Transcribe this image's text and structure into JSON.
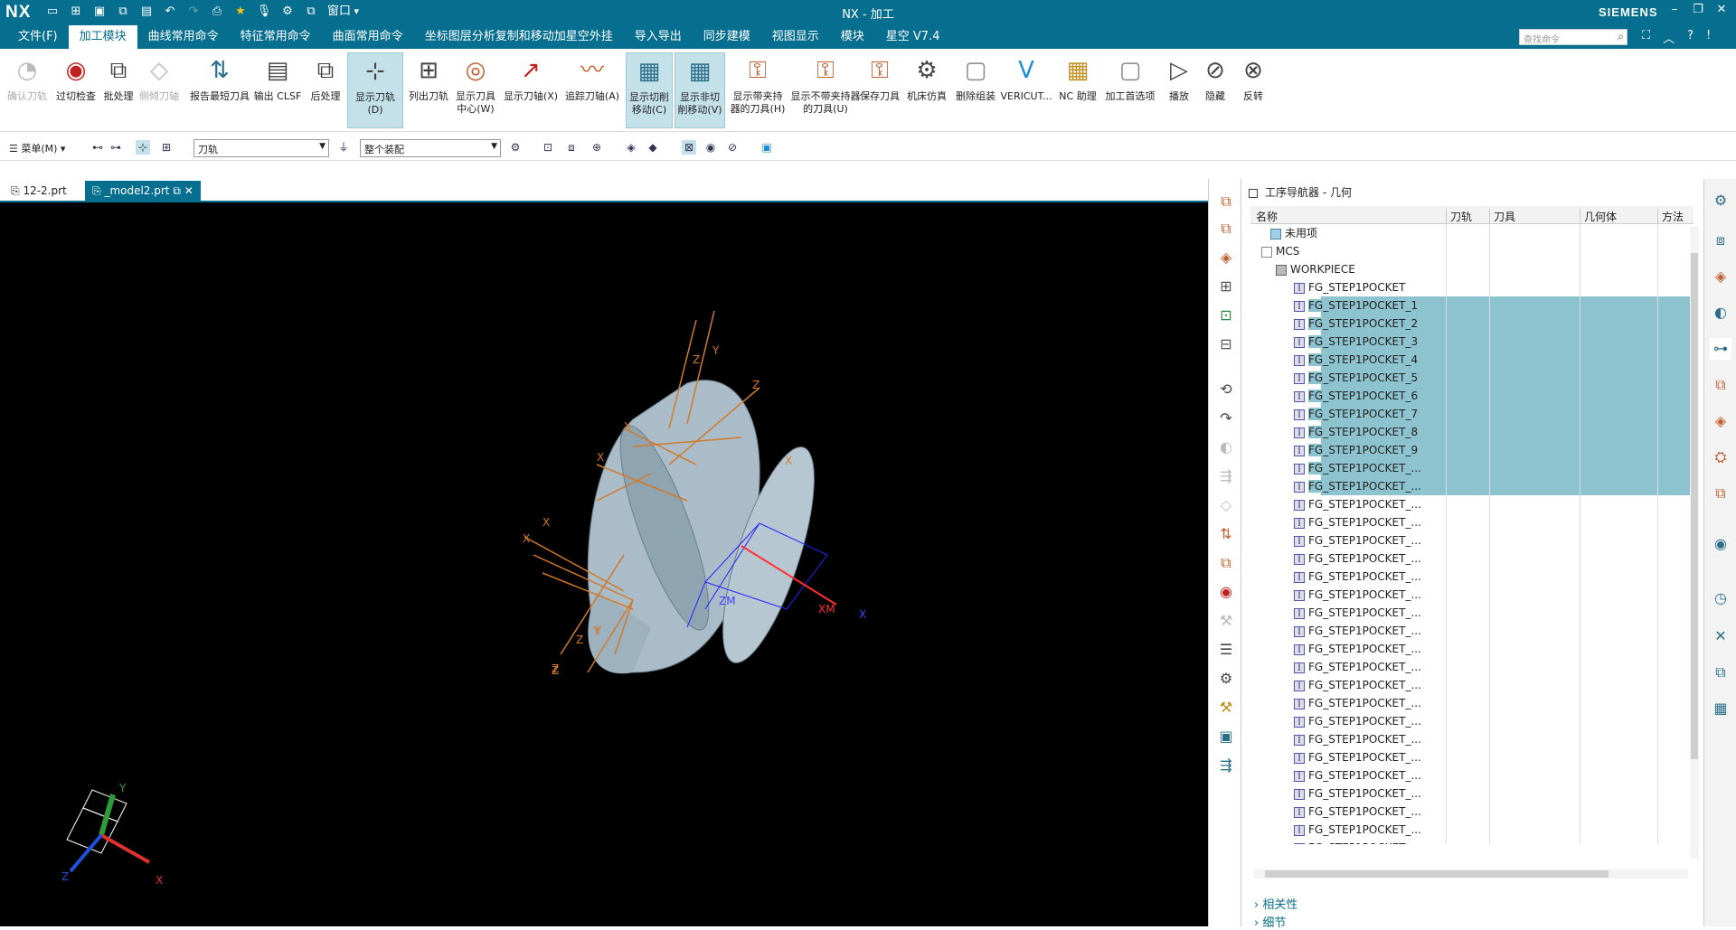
{
  "titlebar": {
    "logo": "NX",
    "title": "NX - 加工",
    "brand": "SIEMENS",
    "window_label": "窗口"
  },
  "menubar": {
    "items": [
      {
        "label": "文件(F)",
        "active": false
      },
      {
        "label": "加工模块",
        "active": true
      },
      {
        "label": "曲线常用命令",
        "active": false
      },
      {
        "label": "特征常用命令",
        "active": false
      },
      {
        "label": "曲面常用命令",
        "active": false
      },
      {
        "label": "坐标图层分析复制和移动加星空外挂",
        "active": false
      },
      {
        "label": "导入导出",
        "active": false
      },
      {
        "label": "同步建模",
        "active": false
      },
      {
        "label": "视图显示",
        "active": false
      },
      {
        "label": "模块",
        "active": false
      },
      {
        "label": "星空 V7.4",
        "active": false
      }
    ],
    "search_placeholder": "查找命令"
  },
  "ribbon": {
    "buttons": [
      {
        "label": "确认刀轨",
        "state": "disabled"
      },
      {
        "label": "过切检查",
        "state": "normal"
      },
      {
        "label": "批处理",
        "state": "normal"
      },
      {
        "label": "侧倾刀轴",
        "state": "disabled"
      },
      {
        "label": "报告最短刀具",
        "state": "normal"
      },
      {
        "label": "输出 CLSF",
        "state": "normal"
      },
      {
        "label": "后处理",
        "state": "normal"
      },
      {
        "label": "显示刀轨(D)",
        "state": "selected"
      },
      {
        "label": "列出刀轨",
        "state": "normal"
      },
      {
        "label": "显示刀具中心(W)",
        "state": "normal"
      },
      {
        "label": "显示刀轴(X)",
        "state": "normal"
      },
      {
        "label": "追踪刀轴(A)",
        "state": "normal"
      },
      {
        "label": "显示切削移动(C)",
        "state": "selected"
      },
      {
        "label": "显示非切削移动(V)",
        "state": "selected"
      },
      {
        "label": "显示带夹持器的刀具(H)",
        "state": "normal"
      },
      {
        "label": "显示不带夹持器的刀具(U)",
        "state": "normal"
      },
      {
        "label": "保存刀具",
        "state": "normal"
      },
      {
        "label": "机床仿真",
        "state": "normal"
      },
      {
        "label": "删除组装",
        "state": "normal"
      },
      {
        "label": "VERICUT...",
        "state": "normal"
      },
      {
        "label": "NC 助理",
        "state": "normal"
      },
      {
        "label": "加工首选项",
        "state": "normal"
      },
      {
        "label": "播放",
        "state": "normal"
      },
      {
        "label": "隐藏",
        "state": "normal"
      },
      {
        "label": "反转",
        "state": "normal"
      }
    ]
  },
  "toolbar2": {
    "menu_label": "菜单(M)",
    "filter_value": "刀轨",
    "scope_value": "整个装配"
  },
  "doctabs": [
    {
      "label": "12-2.prt",
      "active": false
    },
    {
      "label": "_model2.prt",
      "active": true
    }
  ],
  "viewport": {
    "triad": {
      "x": "X",
      "y": "Y",
      "z": "Z"
    },
    "labels": [
      "Z",
      "Y",
      "Z",
      "X",
      "X",
      "X",
      "X",
      "Z",
      "Z",
      "Y",
      "Z",
      "XM",
      "X",
      "ZM",
      "Y",
      "X"
    ]
  },
  "navigator": {
    "title": "工序导航器 - 几何",
    "columns": [
      "名称",
      "刀轨",
      "刀具",
      "几何体",
      "方法"
    ],
    "rows": [
      {
        "name": "未用项",
        "level": 0,
        "selected": false,
        "type": "folder"
      },
      {
        "name": "MCS",
        "level": 0,
        "selected": false,
        "type": "mcs"
      },
      {
        "name": "WORKPIECE",
        "level": 1,
        "selected": false,
        "type": "workpiece"
      },
      {
        "name": "FG_STEP1POCKET",
        "level": 2,
        "selected": false,
        "type": "op"
      },
      {
        "name": "FG_STEP1POCKET_1",
        "level": 2,
        "selected": true,
        "type": "op"
      },
      {
        "name": "FG_STEP1POCKET_2",
        "level": 2,
        "selected": true,
        "type": "op"
      },
      {
        "name": "FG_STEP1POCKET_3",
        "level": 2,
        "selected": true,
        "type": "op"
      },
      {
        "name": "FG_STEP1POCKET_4",
        "level": 2,
        "selected": true,
        "type": "op"
      },
      {
        "name": "FG_STEP1POCKET_5",
        "level": 2,
        "selected": true,
        "type": "op"
      },
      {
        "name": "FG_STEP1POCKET_6",
        "level": 2,
        "selected": true,
        "type": "op"
      },
      {
        "name": "FG_STEP1POCKET_7",
        "level": 2,
        "selected": true,
        "type": "op"
      },
      {
        "name": "FG_STEP1POCKET_8",
        "level": 2,
        "selected": true,
        "type": "op"
      },
      {
        "name": "FG_STEP1POCKET_9",
        "level": 2,
        "selected": true,
        "type": "op"
      },
      {
        "name": "FG_STEP1POCKET_...",
        "level": 2,
        "selected": true,
        "type": "op"
      },
      {
        "name": "FG_STEP1POCKET_...",
        "level": 2,
        "selected": true,
        "type": "op"
      },
      {
        "name": "FG_STEP1POCKET_...",
        "level": 2,
        "selected": false,
        "type": "op"
      },
      {
        "name": "FG_STEP1POCKET_...",
        "level": 2,
        "selected": false,
        "type": "op"
      },
      {
        "name": "FG_STEP1POCKET_...",
        "level": 2,
        "selected": false,
        "type": "op"
      },
      {
        "name": "FG_STEP1POCKET_...",
        "level": 2,
        "selected": false,
        "type": "op"
      },
      {
        "name": "FG_STEP1POCKET_...",
        "level": 2,
        "selected": false,
        "type": "op"
      },
      {
        "name": "FG_STEP1POCKET_...",
        "level": 2,
        "selected": false,
        "type": "op"
      },
      {
        "name": "FG_STEP1POCKET_...",
        "level": 2,
        "selected": false,
        "type": "op"
      },
      {
        "name": "FG_STEP1POCKET_...",
        "level": 2,
        "selected": false,
        "type": "op"
      },
      {
        "name": "FG_STEP1POCKET_...",
        "level": 2,
        "selected": false,
        "type": "op"
      },
      {
        "name": "FG_STEP1POCKET_...",
        "level": 2,
        "selected": false,
        "type": "op"
      },
      {
        "name": "FG_STEP1POCKET_...",
        "level": 2,
        "selected": false,
        "type": "op"
      },
      {
        "name": "FG_STEP1POCKET_...",
        "level": 2,
        "selected": false,
        "type": "op"
      },
      {
        "name": "FG_STEP1POCKET_...",
        "level": 2,
        "selected": false,
        "type": "op"
      },
      {
        "name": "FG_STEP1POCKET_...",
        "level": 2,
        "selected": false,
        "type": "op"
      },
      {
        "name": "FG_STEP1POCKET_...",
        "level": 2,
        "selected": false,
        "type": "op"
      },
      {
        "name": "FG_STEP1POCKET_...",
        "level": 2,
        "selected": false,
        "type": "op"
      },
      {
        "name": "FG_STEP1POCKET_...",
        "level": 2,
        "selected": false,
        "type": "op"
      },
      {
        "name": "FG_STEP1POCKET_...",
        "level": 2,
        "selected": false,
        "type": "op"
      },
      {
        "name": "FG_STEP1POCKET_...",
        "level": 2,
        "selected": false,
        "type": "op"
      },
      {
        "name": "FG_STEP1POCKET_...",
        "level": 2,
        "selected": false,
        "type": "op"
      }
    ],
    "sections": [
      "相关性",
      "细节"
    ]
  },
  "colors": {
    "brand": "#066e8e",
    "selection": "#8dc3cf",
    "viewport_bg": "#000000",
    "axis_orange": "#d07a2a"
  }
}
